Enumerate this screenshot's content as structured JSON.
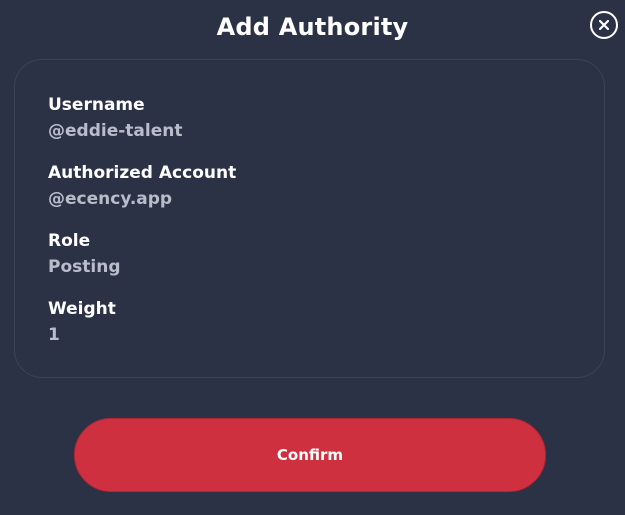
{
  "dialog": {
    "title": "Add Authority",
    "close_icon": "close-circle-icon"
  },
  "fields": [
    {
      "label": "Username",
      "value": "@eddie-talent"
    },
    {
      "label": "Authorized Account",
      "value": "@ecency.app"
    },
    {
      "label": "Role",
      "value": "Posting"
    },
    {
      "label": "Weight",
      "value": "1"
    }
  ],
  "actions": {
    "confirm_label": "Confirm"
  },
  "colors": {
    "background": "#2c3246",
    "card_border": "#3c4358",
    "accent": "#cf3040",
    "label": "#ffffff",
    "value": "#b9bdca"
  }
}
